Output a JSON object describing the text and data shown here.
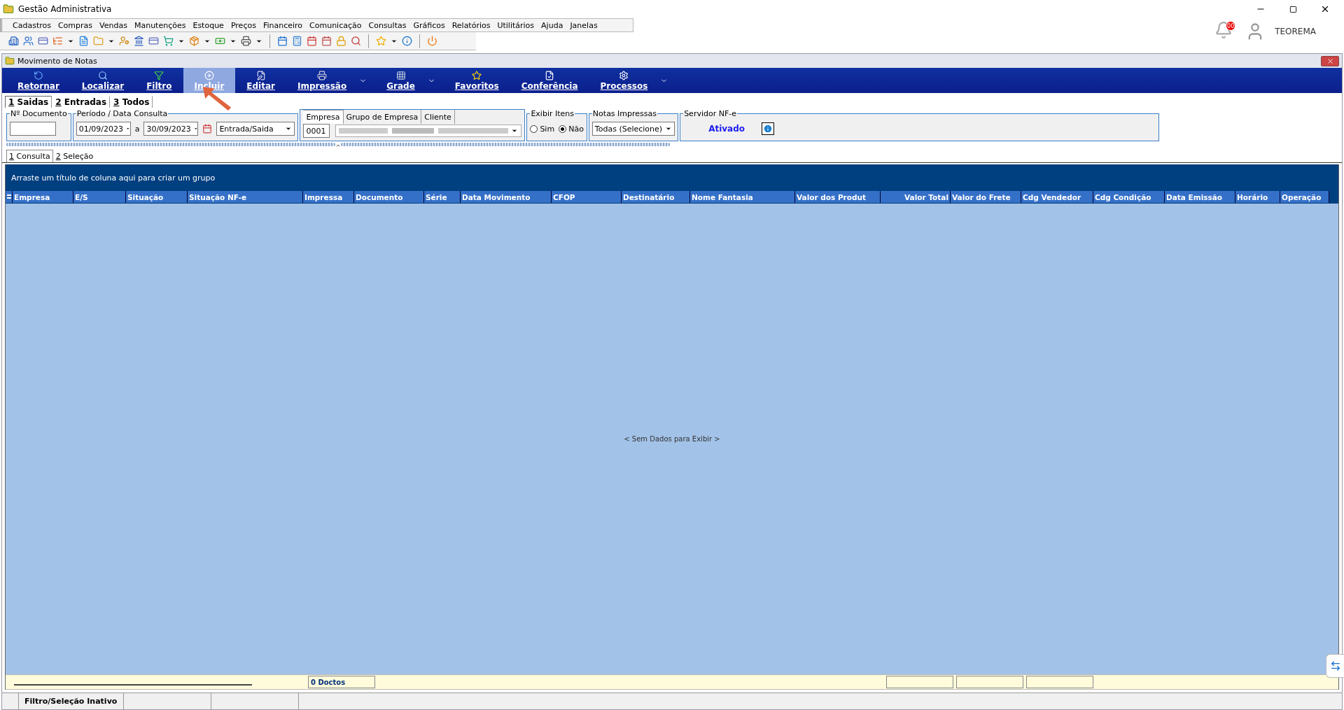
{
  "app_title": "Gestão Administrativa",
  "menu": [
    "Cadastros",
    "Compras",
    "Vendas",
    "Manutenções",
    "Estoque",
    "Preços",
    "Financeiro",
    "Comunicação",
    "Consultas",
    "Gráficos",
    "Relatórios",
    "Utilitários",
    "Ajuda",
    "Janelas"
  ],
  "user": {
    "name": "TEOREMA",
    "notifications": "00"
  },
  "window": {
    "title": "Movimento de Notas"
  },
  "toolbar": [
    {
      "label": "Retornar",
      "selected": false,
      "dropdown": false
    },
    {
      "label": "Localizar",
      "selected": false,
      "dropdown": false
    },
    {
      "label": "Filtro",
      "selected": false,
      "dropdown": false
    },
    {
      "label": "Incluir",
      "selected": true,
      "dropdown": false
    },
    {
      "label": "Editar",
      "selected": false,
      "dropdown": false
    },
    {
      "label": "Impressão",
      "selected": false,
      "dropdown": true
    },
    {
      "label": "Grade",
      "selected": false,
      "dropdown": true
    },
    {
      "label": "Favoritos",
      "selected": false,
      "dropdown": false
    },
    {
      "label": "Conferência",
      "selected": false,
      "dropdown": false
    },
    {
      "label": "Processos",
      "selected": false,
      "dropdown": true
    }
  ],
  "mode_tabs": [
    {
      "key": "1",
      "label": "Saidas",
      "selected": true
    },
    {
      "key": "2",
      "label": "Entradas",
      "selected": false
    },
    {
      "key": "3",
      "label": "Todos",
      "selected": false
    }
  ],
  "filters": {
    "document": {
      "label": "Nº Documento"
    },
    "period": {
      "label": "Período / Data Consulta",
      "from": "01/09/2023",
      "separator": "a",
      "to": "30/09/2023",
      "type": "Entrada/Saida"
    },
    "company_tabs": [
      {
        "label": "Empresa",
        "selected": true
      },
      {
        "label": "Grupo de Empresa",
        "selected": false
      },
      {
        "label": "Cliente",
        "selected": false
      }
    ],
    "company_code": "0001",
    "show_items": {
      "label": "Exibir Itens",
      "options": [
        {
          "label": "Sim",
          "selected": false
        },
        {
          "label": "Não",
          "selected": true
        }
      ]
    },
    "printed": {
      "label": "Notas Impressas",
      "value": "Todas (Selecione)"
    },
    "server": {
      "label": "Servidor NF-e",
      "status": "Ativado"
    }
  },
  "view_tabs": [
    {
      "key": "1",
      "label": "Consulta",
      "selected": true
    },
    {
      "key": "2",
      "label": "Seleção",
      "selected": false
    }
  ],
  "grid": {
    "group_hint": "Arraste um título de coluna aqui para criar um grupo",
    "columns": [
      "Empresa",
      "E/S",
      "Situação",
      "Situação NF-e",
      "Impressa",
      "Documento",
      "Série",
      "Data Movimento",
      "CFOP",
      "Destinatário",
      "Nome Fantasia",
      "Valor dos Produt",
      "Valor Total",
      "Valor do Frete",
      "Cdg Vendedor",
      "Cdg Condição",
      "Data Emissão",
      "Horário",
      "Operação"
    ],
    "empty_text": "< Sem Dados para Exibir >",
    "count": "0 Doctos"
  },
  "status_bar": [
    "Filtro/Seleção Inativo"
  ]
}
